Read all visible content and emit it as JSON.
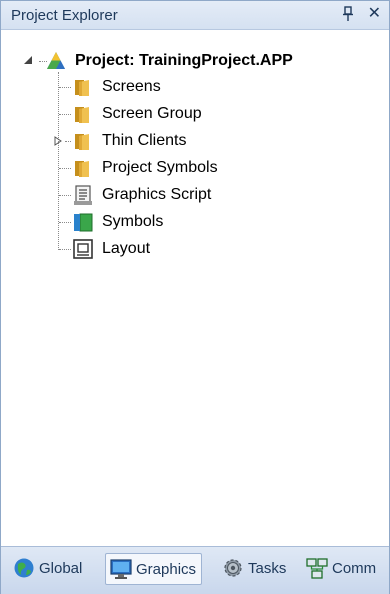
{
  "panel": {
    "title": "Project Explorer",
    "pin_icon": "pin-icon",
    "close_label": "✕"
  },
  "tree": {
    "root": {
      "label": "Project: TrainingProject.APP",
      "icon": "project-icon"
    },
    "items": [
      {
        "label": "Screens",
        "icon": "folder-icon"
      },
      {
        "label": "Screen Group",
        "icon": "folder-icon"
      },
      {
        "label": "Thin Clients",
        "icon": "folder-icon",
        "expandable": true
      },
      {
        "label": "Project Symbols",
        "icon": "folder-icon"
      },
      {
        "label": "Graphics Script",
        "icon": "script-icon"
      },
      {
        "label": "Symbols",
        "icon": "symbols-icon"
      },
      {
        "label": "Layout",
        "icon": "layout-icon"
      }
    ]
  },
  "tabs": [
    {
      "label": "Global",
      "icon": "globe-icon",
      "active": false
    },
    {
      "label": "Graphics",
      "icon": "monitor-icon",
      "active": true
    },
    {
      "label": "Tasks",
      "icon": "gear-icon",
      "active": false
    },
    {
      "label": "Comm",
      "icon": "network-icon",
      "active": false
    }
  ],
  "colors": {
    "title_bar": "#d5e1f1",
    "title_text": "#1e395b",
    "folder": "#e8b84a",
    "tab_bar": "#c9d7ec"
  }
}
